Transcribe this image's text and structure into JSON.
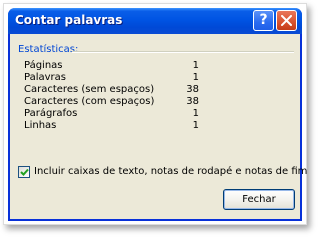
{
  "window": {
    "title": "Contar palavras",
    "help_label": "?",
    "close_label": "×"
  },
  "stats_section": {
    "label": "Estatísticas:",
    "rows": [
      {
        "label": "Páginas",
        "value": "1"
      },
      {
        "label": "Palavras",
        "value": "1"
      },
      {
        "label": "Caracteres (sem espaços)",
        "value": "38"
      },
      {
        "label": "Caracteres (com espaços)",
        "value": "38"
      },
      {
        "label": "Parágrafos",
        "value": "1"
      },
      {
        "label": "Linhas",
        "value": "1"
      }
    ]
  },
  "options": {
    "include_textboxes_label": "Incluir caixas de texto, notas de rodapé e notas de fim",
    "include_textboxes_checked": true
  },
  "buttons": {
    "close_label": "Fechar"
  },
  "colors": {
    "titlebar": "#0054e3",
    "section_label": "#0046d5",
    "dialog_bg": "#ece9d8",
    "close_button": "#d8522f"
  }
}
